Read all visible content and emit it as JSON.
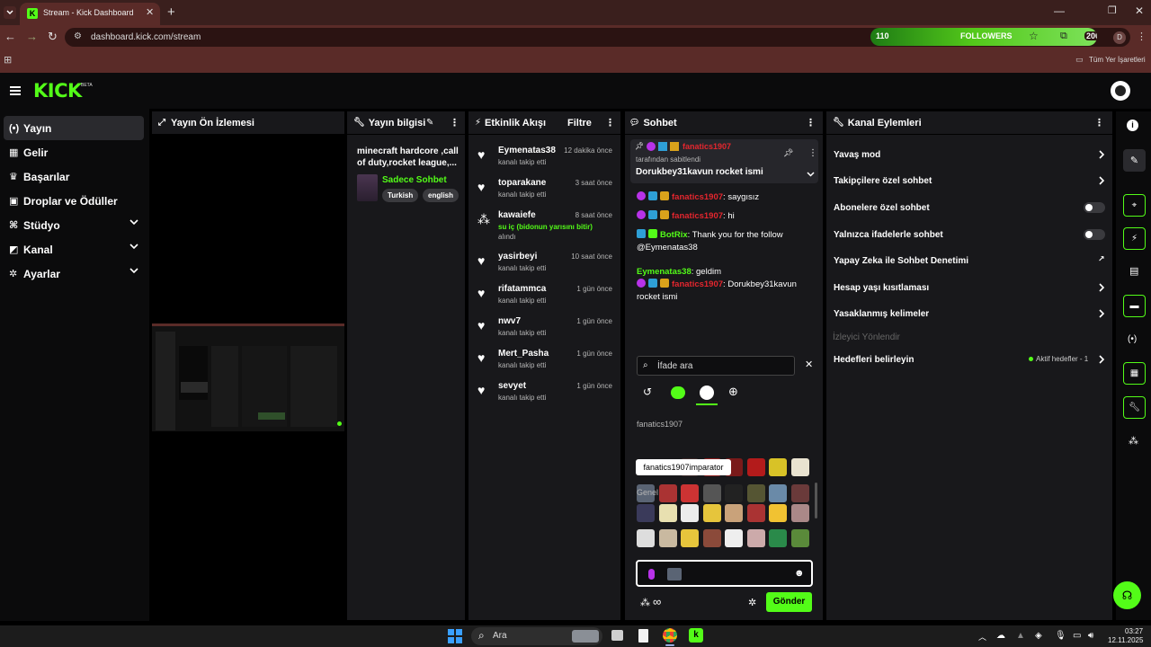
{
  "browser": {
    "tab_title": "Stream - Kick Dashboard",
    "url": "dashboard.kick.com/stream",
    "followers_label": "FOLLOWERS",
    "followers_left": "110",
    "followers_right": "200",
    "profile_initial": "D",
    "bookmarks_all": "Tüm Yer İşaretleri"
  },
  "kick": {
    "logo": "KICK",
    "logo_sup": "BETA"
  },
  "nav": {
    "items": [
      {
        "label": "Yayın",
        "icon": "broadcast-icon"
      },
      {
        "label": "Gelir",
        "icon": "revenue-icon"
      },
      {
        "label": "Başarılar",
        "icon": "trophy-icon"
      },
      {
        "label": "Droplar ve Ödüller",
        "icon": "gift-icon"
      },
      {
        "label": "Stüdyo",
        "icon": "studio-icon"
      },
      {
        "label": "Kanal",
        "icon": "channel-icon"
      },
      {
        "label": "Ayarlar",
        "icon": "gear-icon"
      }
    ]
  },
  "preview": {
    "title": "Yayın Ön İzlemesi"
  },
  "info": {
    "title": "Yayın bilgisi",
    "stream_title": "minecraft hardcore ,call of duty,rocket league,...",
    "category": "Sadece Sohbet",
    "tags": [
      "Turkish",
      "english"
    ]
  },
  "activity": {
    "title": "Etkinlik Akışı",
    "filter": "Filtre",
    "items": [
      {
        "name": "Eymenatas38",
        "time": "12 dakika önce",
        "desc": "kanalı takip etti",
        "extra": "",
        "icon": "heart-icon"
      },
      {
        "name": "toparakane",
        "time": "3 saat önce",
        "desc": "kanalı takip etti",
        "extra": "",
        "icon": "heart-icon"
      },
      {
        "name": "kawaiefe",
        "time": "8 saat önce",
        "desc": "alındı",
        "extra": "su iç (bidonun yarısını bitir)",
        "icon": "points-icon"
      },
      {
        "name": "yasirbeyi",
        "time": "10 saat önce",
        "desc": "kanalı takip etti",
        "extra": "",
        "icon": "heart-icon"
      },
      {
        "name": "rifatammca",
        "time": "1 gün önce",
        "desc": "kanalı takip etti",
        "extra": "",
        "icon": "heart-icon"
      },
      {
        "name": "nwv7",
        "time": "1 gün önce",
        "desc": "kanalı takip etti",
        "extra": "",
        "icon": "heart-icon"
      },
      {
        "name": "Mert_Pasha",
        "time": "1 gün önce",
        "desc": "kanalı takip etti",
        "extra": "",
        "icon": "heart-icon"
      },
      {
        "name": "sevyet",
        "time": "1 gün önce",
        "desc": "kanalı takip etti",
        "extra": "",
        "icon": "heart-icon"
      }
    ]
  },
  "chat": {
    "title": "Sohbet",
    "pinned_user": "fanatics1907",
    "pinned_by": "tarafından sabitlendi",
    "pinned_text": "Dorukbey31kavun rocket ismi",
    "messages": [
      {
        "user": "fanatics1907",
        "sep": ": ",
        "text": "saygısız",
        "color": "#e4262e",
        "badges": 3
      },
      {
        "user": "fanatics1907",
        "sep": ": ",
        "text": "hi",
        "color": "#e4262e",
        "badges": 3
      },
      {
        "user": "BotRix",
        "sep": ": ",
        "text": "Thank you for the follow @Eymenatas38",
        "color": "#53fc18",
        "badges": 2
      },
      {
        "user": "Eymenatas38",
        "sep": ": ",
        "text": "geldim",
        "color": "#53fc18",
        "badges": 0
      },
      {
        "user": "fanatics1907",
        "sep": ": ",
        "text": "Dorukbey31kavun rocket ismi",
        "color": "#e4262e",
        "badges": 3
      }
    ],
    "emote_search_placeholder": "İfade ara",
    "section_channel": "fanatics1907",
    "section_general": "Genel",
    "tooltip": "fanatics1907imparator",
    "send": "Gönder"
  },
  "actions": {
    "title": "Kanal Eylemleri",
    "items": [
      {
        "label": "Yavaş mod",
        "control": "chevron"
      },
      {
        "label": "Takipçilere özel sohbet",
        "control": "chevron"
      },
      {
        "label": "Abonelere özel sohbet",
        "control": "toggle"
      },
      {
        "label": "Yalnızca ifadelerle sohbet",
        "control": "toggle"
      },
      {
        "label": "Yapay Zeka ile Sohbet Denetimi",
        "control": "external"
      },
      {
        "label": "Hesap yaşı kısıtlaması",
        "control": "chevron"
      },
      {
        "label": "Yasaklanmış kelimeler",
        "control": "chevron"
      }
    ],
    "section": "İzleyici Yönlendir",
    "goals_label": "Hedefleri belirleyin",
    "goals_status": "Aktif hedefler - 1"
  },
  "taskbar": {
    "search": "Ara",
    "time": "03:27",
    "date": "12.11.2025"
  },
  "colors": {
    "accent": "#53fc18",
    "panel": "#18181b",
    "chrome": "#5a2b28"
  }
}
